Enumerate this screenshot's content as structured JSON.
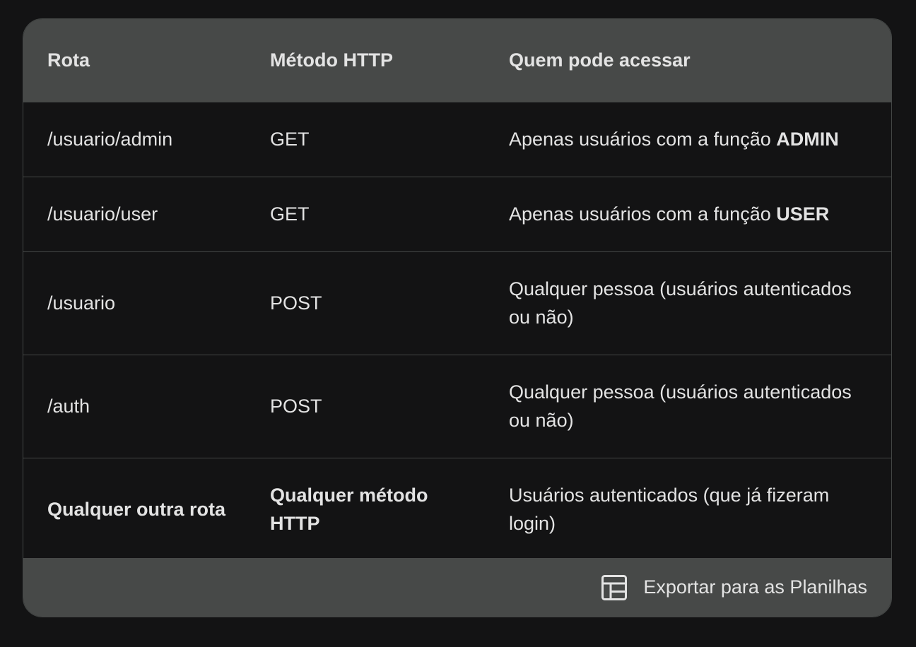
{
  "table": {
    "headers": [
      "Rota",
      "Método HTTP",
      "Quem pode acessar"
    ],
    "rows": [
      {
        "route": "/usuario/admin",
        "method": "GET",
        "access_prefix": "Apenas usuários com a função ",
        "access_bold": "ADMIN"
      },
      {
        "route": "/usuario/user",
        "method": "GET",
        "access_prefix": "Apenas usuários com a função ",
        "access_bold": "USER"
      },
      {
        "route": "/usuario",
        "method": "POST",
        "access": "Qualquer pessoa (usuários autenticados ou não)"
      },
      {
        "route": "/auth",
        "method": "POST",
        "access": "Qualquer pessoa (usuários autenticados ou não)"
      },
      {
        "route": "Qualquer outra rota",
        "method": "Qualquer método HTTP",
        "access": "Usuários autenticados (que já fizeram login)"
      }
    ]
  },
  "footer": {
    "export_label": "Exportar para as Planilhas",
    "export_icon": "table-chart-icon"
  }
}
